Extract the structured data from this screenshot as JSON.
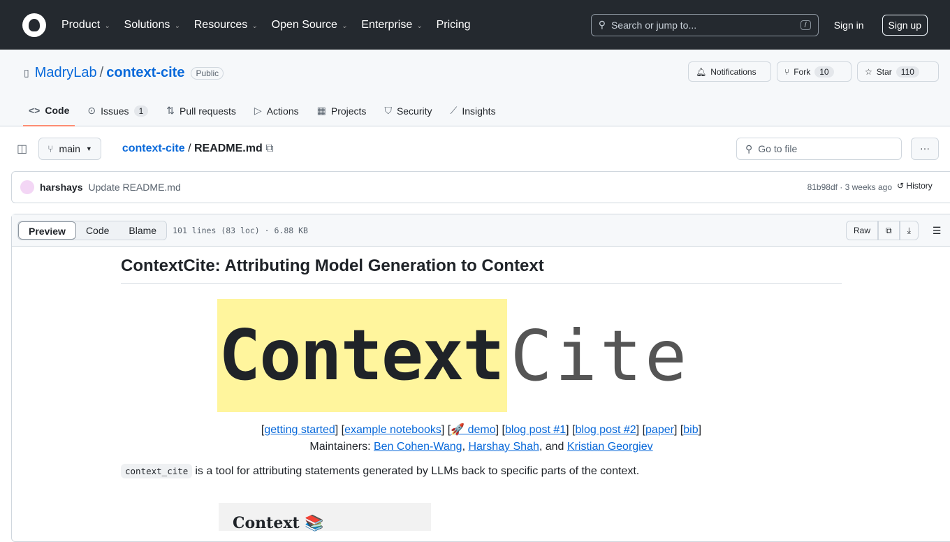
{
  "header": {
    "nav": [
      "Product",
      "Solutions",
      "Resources",
      "Open Source",
      "Enterprise",
      "Pricing"
    ],
    "search_placeholder": "Search or jump to...",
    "search_key": "/",
    "sign_in": "Sign in",
    "sign_up": "Sign up"
  },
  "repo": {
    "owner": "MadryLab",
    "name": "context-cite",
    "visibility": "Public",
    "notifications": "Notifications",
    "fork": "Fork",
    "fork_count": "10",
    "star": "Star",
    "star_count": "110"
  },
  "tabs": [
    {
      "label": "Code",
      "icon": "code-icon"
    },
    {
      "label": "Issues",
      "count": "1",
      "icon": "issue-icon"
    },
    {
      "label": "Pull requests",
      "icon": "pull-request-icon"
    },
    {
      "label": "Actions",
      "icon": "play-icon"
    },
    {
      "label": "Projects",
      "icon": "table-icon"
    },
    {
      "label": "Security",
      "icon": "shield-icon"
    },
    {
      "label": "Insights",
      "icon": "graph-icon"
    }
  ],
  "filebar": {
    "branch": "main",
    "crumb_repo": "context-cite",
    "crumb_sep": "/",
    "crumb_file": "README.md",
    "go_to_file": "Go to file"
  },
  "commit": {
    "author": "harshays",
    "message": "Update README.md",
    "meta": "81b98df · 3 weeks ago",
    "history": "History"
  },
  "file": {
    "views": [
      "Preview",
      "Code",
      "Blame"
    ],
    "info": "101 lines (83 loc) · 6.88 KB",
    "raw": "Raw"
  },
  "readme": {
    "title": "ContextCite: Attributing Model Generation to Context",
    "hero_bold": "Context",
    "hero_light": "Cite",
    "links": [
      "getting started",
      "example notebooks",
      "🚀 demo",
      "blog post #1",
      "blog post #2",
      "paper",
      "bib"
    ],
    "maintainers_label": "Maintainers:",
    "maintainers": [
      "Ben Cohen-Wang",
      "Harshay Shah",
      "Kristian Georgiev"
    ],
    "and": ", and",
    "intro_code": "context_cite",
    "intro": "is a tool for attributing statements generated by LLMs back to specific parts of the context.",
    "image_heading": "Context 📚"
  }
}
